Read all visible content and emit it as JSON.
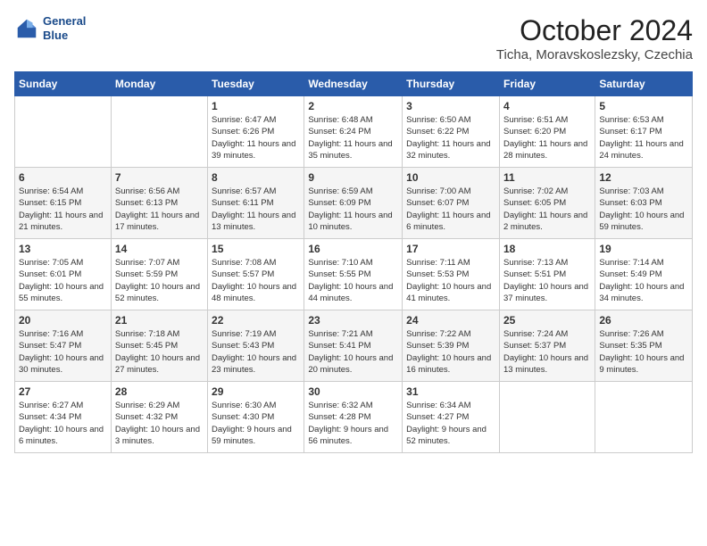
{
  "header": {
    "logo_line1": "General",
    "logo_line2": "Blue",
    "month": "October 2024",
    "location": "Ticha, Moravskoslezsky, Czechia"
  },
  "weekdays": [
    "Sunday",
    "Monday",
    "Tuesday",
    "Wednesday",
    "Thursday",
    "Friday",
    "Saturday"
  ],
  "weeks": [
    [
      {
        "day": "",
        "info": ""
      },
      {
        "day": "",
        "info": ""
      },
      {
        "day": "1",
        "info": "Sunrise: 6:47 AM\nSunset: 6:26 PM\nDaylight: 11 hours and 39 minutes."
      },
      {
        "day": "2",
        "info": "Sunrise: 6:48 AM\nSunset: 6:24 PM\nDaylight: 11 hours and 35 minutes."
      },
      {
        "day": "3",
        "info": "Sunrise: 6:50 AM\nSunset: 6:22 PM\nDaylight: 11 hours and 32 minutes."
      },
      {
        "day": "4",
        "info": "Sunrise: 6:51 AM\nSunset: 6:20 PM\nDaylight: 11 hours and 28 minutes."
      },
      {
        "day": "5",
        "info": "Sunrise: 6:53 AM\nSunset: 6:17 PM\nDaylight: 11 hours and 24 minutes."
      }
    ],
    [
      {
        "day": "6",
        "info": "Sunrise: 6:54 AM\nSunset: 6:15 PM\nDaylight: 11 hours and 21 minutes."
      },
      {
        "day": "7",
        "info": "Sunrise: 6:56 AM\nSunset: 6:13 PM\nDaylight: 11 hours and 17 minutes."
      },
      {
        "day": "8",
        "info": "Sunrise: 6:57 AM\nSunset: 6:11 PM\nDaylight: 11 hours and 13 minutes."
      },
      {
        "day": "9",
        "info": "Sunrise: 6:59 AM\nSunset: 6:09 PM\nDaylight: 11 hours and 10 minutes."
      },
      {
        "day": "10",
        "info": "Sunrise: 7:00 AM\nSunset: 6:07 PM\nDaylight: 11 hours and 6 minutes."
      },
      {
        "day": "11",
        "info": "Sunrise: 7:02 AM\nSunset: 6:05 PM\nDaylight: 11 hours and 2 minutes."
      },
      {
        "day": "12",
        "info": "Sunrise: 7:03 AM\nSunset: 6:03 PM\nDaylight: 10 hours and 59 minutes."
      }
    ],
    [
      {
        "day": "13",
        "info": "Sunrise: 7:05 AM\nSunset: 6:01 PM\nDaylight: 10 hours and 55 minutes."
      },
      {
        "day": "14",
        "info": "Sunrise: 7:07 AM\nSunset: 5:59 PM\nDaylight: 10 hours and 52 minutes."
      },
      {
        "day": "15",
        "info": "Sunrise: 7:08 AM\nSunset: 5:57 PM\nDaylight: 10 hours and 48 minutes."
      },
      {
        "day": "16",
        "info": "Sunrise: 7:10 AM\nSunset: 5:55 PM\nDaylight: 10 hours and 44 minutes."
      },
      {
        "day": "17",
        "info": "Sunrise: 7:11 AM\nSunset: 5:53 PM\nDaylight: 10 hours and 41 minutes."
      },
      {
        "day": "18",
        "info": "Sunrise: 7:13 AM\nSunset: 5:51 PM\nDaylight: 10 hours and 37 minutes."
      },
      {
        "day": "19",
        "info": "Sunrise: 7:14 AM\nSunset: 5:49 PM\nDaylight: 10 hours and 34 minutes."
      }
    ],
    [
      {
        "day": "20",
        "info": "Sunrise: 7:16 AM\nSunset: 5:47 PM\nDaylight: 10 hours and 30 minutes."
      },
      {
        "day": "21",
        "info": "Sunrise: 7:18 AM\nSunset: 5:45 PM\nDaylight: 10 hours and 27 minutes."
      },
      {
        "day": "22",
        "info": "Sunrise: 7:19 AM\nSunset: 5:43 PM\nDaylight: 10 hours and 23 minutes."
      },
      {
        "day": "23",
        "info": "Sunrise: 7:21 AM\nSunset: 5:41 PM\nDaylight: 10 hours and 20 minutes."
      },
      {
        "day": "24",
        "info": "Sunrise: 7:22 AM\nSunset: 5:39 PM\nDaylight: 10 hours and 16 minutes."
      },
      {
        "day": "25",
        "info": "Sunrise: 7:24 AM\nSunset: 5:37 PM\nDaylight: 10 hours and 13 minutes."
      },
      {
        "day": "26",
        "info": "Sunrise: 7:26 AM\nSunset: 5:35 PM\nDaylight: 10 hours and 9 minutes."
      }
    ],
    [
      {
        "day": "27",
        "info": "Sunrise: 6:27 AM\nSunset: 4:34 PM\nDaylight: 10 hours and 6 minutes."
      },
      {
        "day": "28",
        "info": "Sunrise: 6:29 AM\nSunset: 4:32 PM\nDaylight: 10 hours and 3 minutes."
      },
      {
        "day": "29",
        "info": "Sunrise: 6:30 AM\nSunset: 4:30 PM\nDaylight: 9 hours and 59 minutes."
      },
      {
        "day": "30",
        "info": "Sunrise: 6:32 AM\nSunset: 4:28 PM\nDaylight: 9 hours and 56 minutes."
      },
      {
        "day": "31",
        "info": "Sunrise: 6:34 AM\nSunset: 4:27 PM\nDaylight: 9 hours and 52 minutes."
      },
      {
        "day": "",
        "info": ""
      },
      {
        "day": "",
        "info": ""
      }
    ]
  ]
}
